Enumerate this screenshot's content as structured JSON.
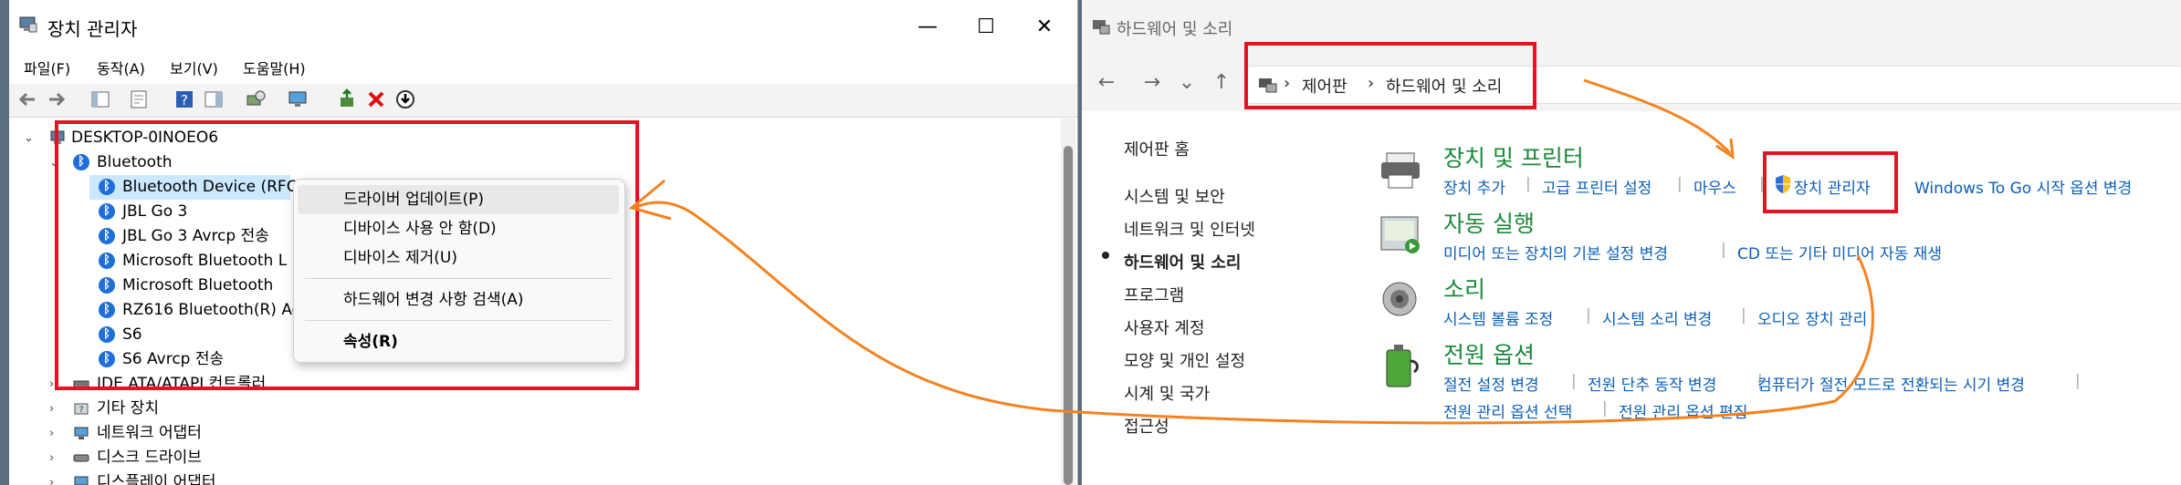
{
  "device_manager": {
    "title": "장치 관리자",
    "window_buttons": {
      "minimize": "—",
      "maximize": "☐",
      "close": "✕"
    },
    "menu": [
      "파일(F)",
      "동작(A)",
      "보기(V)",
      "도움말(H)"
    ],
    "tree": {
      "root": "DESKTOP-0INOEO6",
      "bluetooth_group": "Bluetooth",
      "bluetooth_devices": [
        "Bluetooth Device (RFC",
        "JBL Go 3",
        "JBL Go 3 Avrcp 전송",
        "Microsoft Bluetooth L",
        "Microsoft Bluetooth",
        "RZ616 Bluetooth(R) Ac",
        "S6",
        "S6 Avrcp 전송"
      ],
      "other_groups": [
        "IDE ATA/ATAPI 컨트롤러",
        "기타 장치",
        "네트워크 어댑터",
        "디스크 드라이브",
        "디스플레이 어댑터"
      ]
    },
    "context_menu": {
      "items": [
        "드라이버 업데이트(P)",
        "디바이스 사용 안 함(D)",
        "디바이스 제거(U)"
      ],
      "scan": "하드웨어 변경 사항 검색(A)",
      "properties": "속성(R)"
    }
  },
  "control_panel": {
    "title": "하드웨어 및 소리",
    "breadcrumb": [
      "제어판",
      "하드웨어 및 소리"
    ],
    "crumb_sep": "›",
    "sidebar": [
      "제어판 홈",
      "시스템 및 보안",
      "네트워크 및 인터넷",
      "하드웨어 및 소리",
      "프로그램",
      "사용자 계정",
      "모양 및 개인 설정",
      "시계 및 국가",
      "접근성"
    ],
    "sidebar_active_index": 3,
    "categories": [
      {
        "title": "장치 및 프린터",
        "links": [
          "장치 추가",
          "고급 프린터 설정",
          "마우스",
          "장치 관리자",
          "Windows To Go 시작 옵션 변경"
        ]
      },
      {
        "title": "자동 실행",
        "links": [
          "미디어 또는 장치의 기본 설정 변경",
          "CD 또는 기타 미디어 자동 재생"
        ]
      },
      {
        "title": "소리",
        "links": [
          "시스템 볼륨 조정",
          "시스템 소리 변경",
          "오디오 장치 관리"
        ]
      },
      {
        "title": "전원 옵션",
        "links": [
          "절전 설정 변경",
          "전원 단추 동작 변경",
          "컴퓨터가 절전 모드로 전환되는 시기 변경",
          "전원 관리 옵션 선택",
          "전원 관리 옵션 편집"
        ]
      }
    ]
  },
  "colors": {
    "annotation_red": "#e81123",
    "arrow_orange": "#f5821f",
    "link_blue": "#0b5fb8",
    "category_green": "#1a8a3a"
  }
}
